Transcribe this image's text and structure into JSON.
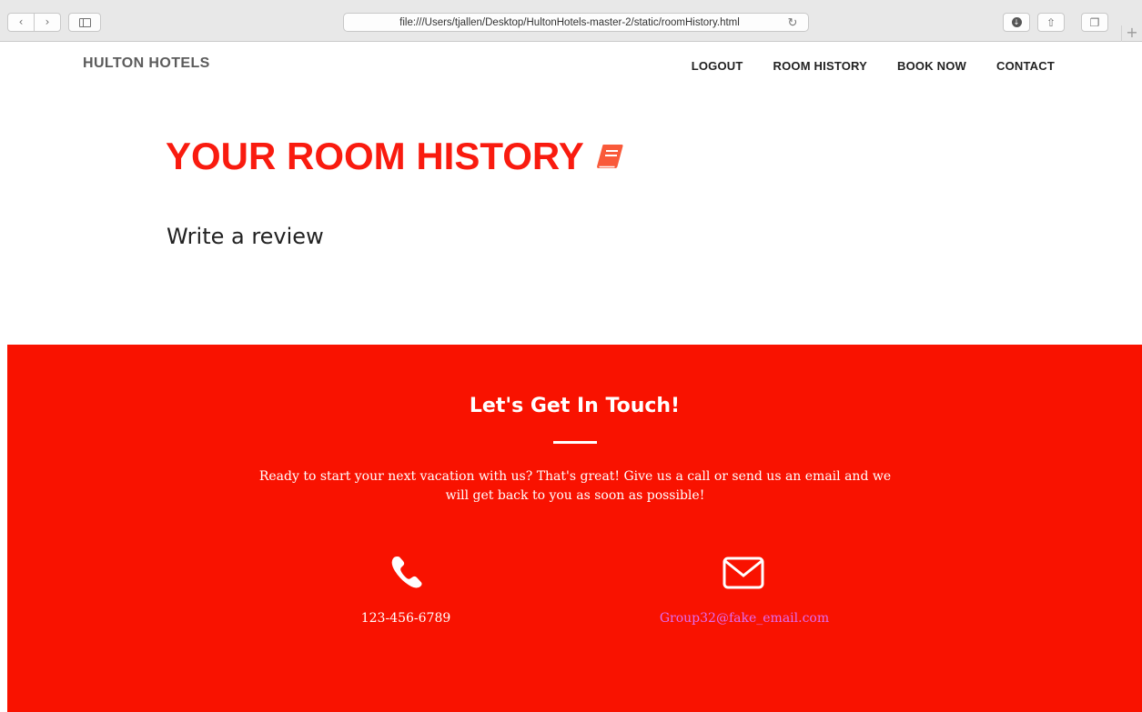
{
  "browser": {
    "url": "file:///Users/tjallen/Desktop/HultonHotels-master-2/static/roomHistory.html",
    "back_icon": "chevron-left-icon",
    "forward_icon": "chevron-right-icon",
    "sidebar_icon": "sidebar-icon",
    "reload_icon": "reload-icon",
    "download_icon": "download-icon",
    "share_icon": "share-icon",
    "tabs_icon": "tabs-icon",
    "new_tab_icon": "plus-icon",
    "glyphs": {
      "back": "‹",
      "forward": "›",
      "reload": "↻",
      "download": "↓",
      "share": "⇧",
      "tabs": "❐",
      "new_tab": "+"
    }
  },
  "nav": {
    "brand": "HULTON HOTELS",
    "links": [
      "LOGOUT",
      "ROOM HISTORY",
      "BOOK NOW",
      "CONTACT"
    ]
  },
  "main": {
    "title": "YOUR ROOM HISTORY",
    "title_icon": "book-icon",
    "review_link": "Write a review"
  },
  "contact": {
    "heading": "Let's Get In Touch!",
    "text": "Ready to start your next vacation with us? That's great! Give us a call or send us an email and we will get back to you as soon as possible!",
    "phone": "123-456-6789",
    "phone_icon": "phone-icon",
    "email": "Group32@fake_email.com",
    "email_icon": "envelope-icon"
  },
  "colors": {
    "accent": "#f91b0f",
    "footer_bg": "#f91200",
    "email_link": "#e06cf0",
    "brand_text": "#5b5b5b"
  }
}
